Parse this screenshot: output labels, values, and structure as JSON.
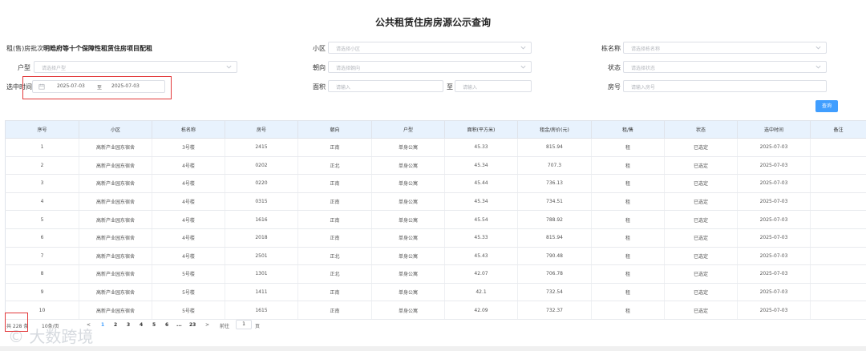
{
  "title": "公共租赁住房房源公示查询",
  "filters": {
    "batch_label": "租(售)房批次",
    "batch_value": "明皓府等十个保障性租赁住房项目配租",
    "community_label": "小区",
    "community_placeholder": "请选择小区",
    "building_label": "栋名称",
    "building_placeholder": "请选择栋名称",
    "unit_type_label": "户型",
    "unit_type_placeholder": "请选择户型",
    "orientation_label": "朝向",
    "orientation_placeholder": "请选择朝向",
    "status_label": "状态",
    "status_placeholder": "请选择状态",
    "time_label": "选中时间",
    "date_start": "2025-07-03",
    "date_sep": "至",
    "date_end": "2025-07-03",
    "area_label": "面积",
    "area_min_placeholder": "请输入",
    "area_to": "至",
    "area_max_placeholder": "请输入",
    "room_label": "房号",
    "room_placeholder": "请输入房号",
    "query_button": "查询"
  },
  "table": {
    "columns": [
      "序号",
      "小区",
      "栋名称",
      "房号",
      "朝向",
      "户型",
      "面积(平方米)",
      "租金/房价(元)",
      "租/售",
      "状态",
      "选中时间",
      "备注"
    ],
    "rows": [
      {
        "c0": "1",
        "c1": "高新产业园东宿舍",
        "c2": "3号楼",
        "c3": "2415",
        "c4": "正南",
        "c5": "单身公寓",
        "c6": "45.33",
        "c7": "815.94",
        "c8": "租",
        "c9": "已选定",
        "c10": "2025-07-03",
        "c11": ""
      },
      {
        "c0": "2",
        "c1": "高新产业园东宿舍",
        "c2": "4号楼",
        "c3": "0202",
        "c4": "正北",
        "c5": "单身公寓",
        "c6": "45.34",
        "c7": "707.3",
        "c8": "租",
        "c9": "已选定",
        "c10": "2025-07-03",
        "c11": ""
      },
      {
        "c0": "3",
        "c1": "高新产业园东宿舍",
        "c2": "4号楼",
        "c3": "0220",
        "c4": "正南",
        "c5": "单身公寓",
        "c6": "45.44",
        "c7": "736.13",
        "c8": "租",
        "c9": "已选定",
        "c10": "2025-07-03",
        "c11": ""
      },
      {
        "c0": "4",
        "c1": "高新产业园东宿舍",
        "c2": "4号楼",
        "c3": "0315",
        "c4": "正南",
        "c5": "单身公寓",
        "c6": "45.34",
        "c7": "734.51",
        "c8": "租",
        "c9": "已选定",
        "c10": "2025-07-03",
        "c11": ""
      },
      {
        "c0": "5",
        "c1": "高新产业园东宿舍",
        "c2": "4号楼",
        "c3": "1616",
        "c4": "正南",
        "c5": "单身公寓",
        "c6": "45.54",
        "c7": "788.92",
        "c8": "租",
        "c9": "已选定",
        "c10": "2025-07-03",
        "c11": ""
      },
      {
        "c0": "6",
        "c1": "高新产业园东宿舍",
        "c2": "4号楼",
        "c3": "2018",
        "c4": "正南",
        "c5": "单身公寓",
        "c6": "45.33",
        "c7": "815.94",
        "c8": "租",
        "c9": "已选定",
        "c10": "2025-07-03",
        "c11": ""
      },
      {
        "c0": "7",
        "c1": "高新产业园东宿舍",
        "c2": "4号楼",
        "c3": "2501",
        "c4": "正北",
        "c5": "单身公寓",
        "c6": "45.43",
        "c7": "790.48",
        "c8": "租",
        "c9": "已选定",
        "c10": "2025-07-03",
        "c11": ""
      },
      {
        "c0": "8",
        "c1": "高新产业园东宿舍",
        "c2": "5号楼",
        "c3": "1301",
        "c4": "正北",
        "c5": "单身公寓",
        "c6": "42.07",
        "c7": "706.78",
        "c8": "租",
        "c9": "已选定",
        "c10": "2025-07-03",
        "c11": ""
      },
      {
        "c0": "9",
        "c1": "高新产业园东宿舍",
        "c2": "5号楼",
        "c3": "1411",
        "c4": "正南",
        "c5": "单身公寓",
        "c6": "42.1",
        "c7": "732.54",
        "c8": "租",
        "c9": "已选定",
        "c10": "2025-07-03",
        "c11": ""
      },
      {
        "c0": "10",
        "c1": "高新产业园东宿舍",
        "c2": "5号楼",
        "c3": "1615",
        "c4": "正南",
        "c5": "单身公寓",
        "c6": "42.09",
        "c7": "732.37",
        "c8": "租",
        "c9": "已选定",
        "c10": "2025-07-03",
        "c11": ""
      }
    ]
  },
  "pagination": {
    "total": "共 228 条",
    "page_size": "10条/页",
    "prev": "<",
    "pages": [
      "1",
      "2",
      "3",
      "4",
      "5",
      "6",
      "...",
      "23"
    ],
    "next": ">",
    "goto_label": "前往",
    "goto_value": "1",
    "goto_suffix": "页"
  },
  "watermark": "大数跨境",
  "colors": {
    "accent": "#409eff",
    "header_bg": "#e8f2fd",
    "highlight": "#e2383a"
  }
}
